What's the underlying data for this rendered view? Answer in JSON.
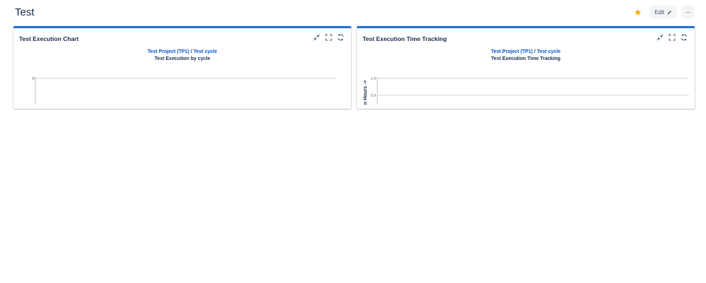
{
  "page": {
    "title": "Test",
    "edit_label": "Edit",
    "more_label": "···"
  },
  "colors": {
    "accent": "#2174d6",
    "link": "#0052cc",
    "star": "#ffab00"
  },
  "icons": {
    "favorite": "star-icon",
    "edit": "pencil-icon",
    "more": "more-icon",
    "minimize": "minimize-icon",
    "fullscreen": "fullscreen-icon",
    "refresh": "refresh-icon"
  },
  "gadgets": [
    {
      "title": "Test Execution Chart",
      "project_link": "Test Project (TP1)",
      "separator": "/",
      "cycle_link": "Test cycle",
      "subtitle": "Test Execution by cycle"
    },
    {
      "title": "Test Execution Time Tracking",
      "project_link": "Test Project (TP1)",
      "separator": "/",
      "cycle_link": "Test cycle",
      "subtitle": "Test Execution Time Tracking"
    }
  ],
  "chart_data": [
    {
      "type": "bar",
      "title": "Test Execution by cycle",
      "categories": [],
      "series": [],
      "yticks": [
        3
      ],
      "ylabel": "",
      "grid": true
    },
    {
      "type": "line",
      "title": "Test Execution Time Tracking",
      "categories": [],
      "series": [],
      "yticks": [
        1.0,
        0.9
      ],
      "ytick_labels": [
        "1.0",
        "0.9"
      ],
      "ylabel": "n Hours ->",
      "grid": true
    }
  ]
}
